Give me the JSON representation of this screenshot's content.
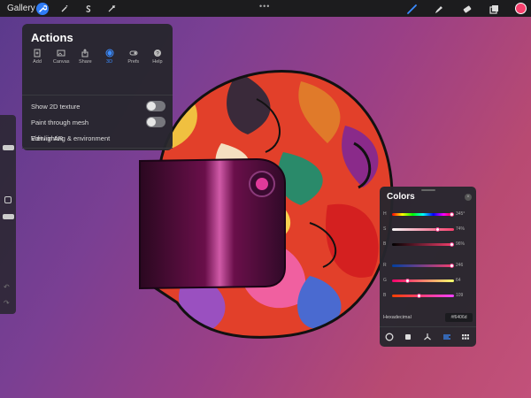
{
  "topbar": {
    "gallery_label": "Gallery",
    "dots_label": "•••",
    "left_tools": [
      "actions-wrench-icon",
      "adjustments-wand-icon",
      "selection-s-icon",
      "transform-arrow-icon"
    ],
    "right_tools": [
      "brush-icon",
      "smudge-icon",
      "eraser-icon",
      "layers-icon"
    ],
    "current_color": "#f6406d"
  },
  "actions": {
    "title": "Actions",
    "tabs": [
      {
        "label": "Add",
        "icon": "add-file-icon",
        "active": false
      },
      {
        "label": "Canvas",
        "icon": "canvas-icon",
        "active": false
      },
      {
        "label": "Share",
        "icon": "share-icon",
        "active": false
      },
      {
        "label": "3D",
        "icon": "cube-3d-icon",
        "active": true
      },
      {
        "label": "Prefs",
        "icon": "toggle-prefs-icon",
        "active": false
      },
      {
        "label": "Help",
        "icon": "question-icon",
        "active": false
      }
    ],
    "rows": [
      {
        "label": "Show 2D texture",
        "toggle": false
      },
      {
        "label": "Paint through mesh",
        "toggle": false
      },
      {
        "label": "Edit lighting & environment"
      },
      {
        "label": "View in AR"
      }
    ]
  },
  "colors": {
    "title": "Colors",
    "close_label": "×",
    "hsb": [
      {
        "label": "H",
        "value": "345°",
        "fraction": 0.96
      },
      {
        "label": "S",
        "value": "74%",
        "fraction": 0.74
      },
      {
        "label": "B",
        "value": "96%",
        "fraction": 0.96
      }
    ],
    "rgb": [
      {
        "label": "R",
        "value": "246",
        "fraction": 0.96
      },
      {
        "label": "G",
        "value": "64",
        "fraction": 0.25
      },
      {
        "label": "B",
        "value": "109",
        "fraction": 0.43
      }
    ],
    "hex_label": "Hexadecimal",
    "hex_value": "#f6406d",
    "modes": [
      "disc-icon",
      "classic-square-icon",
      "harmony-icon",
      "value-sliders-icon",
      "palettes-grid-icon"
    ],
    "active_mode": 3
  },
  "colors_accent": "#2f7cf6"
}
